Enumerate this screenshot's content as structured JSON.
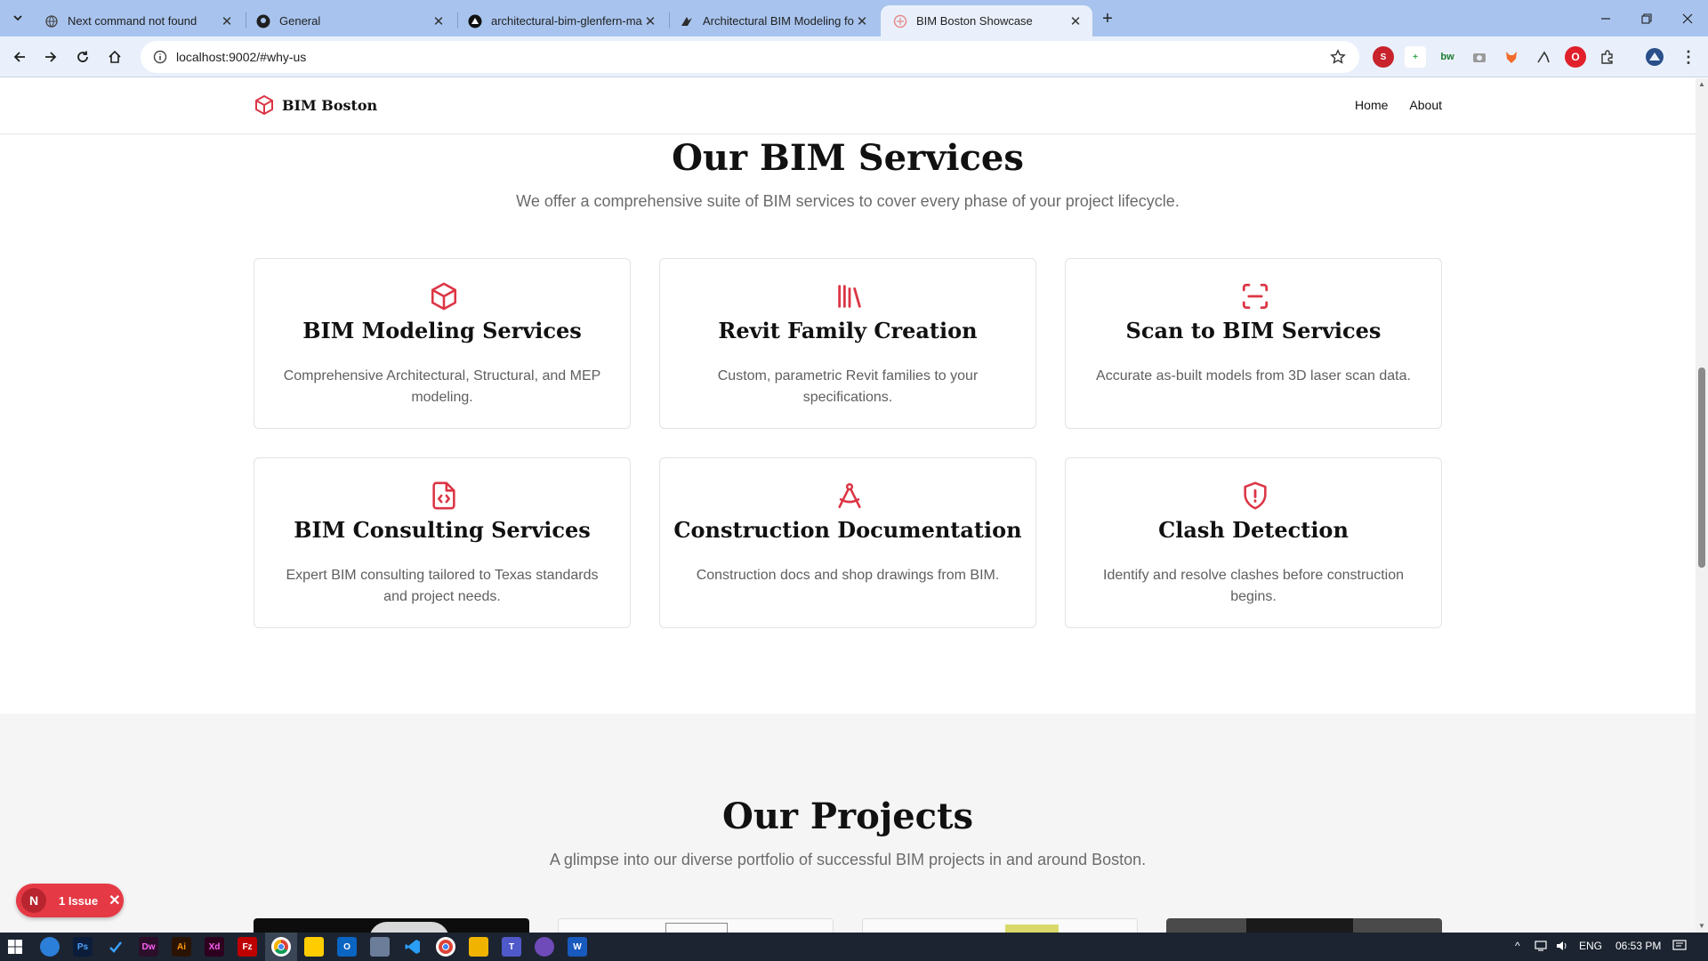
{
  "browser": {
    "tabs": [
      {
        "title": "Next command not found"
      },
      {
        "title": "General"
      },
      {
        "title": "architectural-bim-glenfern-mas"
      },
      {
        "title": "Architectural BIM Modeling for"
      },
      {
        "title": "BIM Boston Showcase"
      }
    ],
    "url": "localhost:9002/#why-us"
  },
  "site": {
    "brand": "BIM Boston",
    "nav": {
      "home": "Home",
      "about": "About"
    },
    "services": {
      "title": "Our BIM Services",
      "subtitle": "We offer a comprehensive suite of BIM services to cover every phase of your project lifecycle.",
      "cards": [
        {
          "title": "BIM Modeling Services",
          "desc": "Comprehensive Architectural, Structural, and MEP modeling.",
          "icon": "cube-icon"
        },
        {
          "title": "Revit Family Creation",
          "desc": "Custom, parametric Revit families to your specifications.",
          "icon": "library-icon"
        },
        {
          "title": "Scan to BIM Services",
          "desc": "Accurate as-built models from 3D laser scan data.",
          "icon": "scan-icon"
        },
        {
          "title": "BIM Consulting Services",
          "desc": "Expert BIM consulting tailored to Texas standards and project needs.",
          "icon": "file-code-icon"
        },
        {
          "title": "Construction Documentation",
          "desc": "Construction docs and shop drawings from BIM.",
          "icon": "compass-icon"
        },
        {
          "title": "Clash Detection",
          "desc": "Identify and resolve clashes before construction begins.",
          "icon": "shield-alert-icon"
        }
      ]
    },
    "projects": {
      "title": "Our Projects",
      "subtitle": "A glimpse into our diverse portfolio of successful BIM projects in and around Boston."
    }
  },
  "issue_badge": {
    "initial": "N",
    "label": "1 Issue"
  },
  "taskbar": {
    "language": "ENG",
    "time": "06:53 PM",
    "apps": [
      "Ps",
      "Dw",
      "Ai",
      "Xd",
      "Fz",
      "W"
    ]
  },
  "colors": {
    "accent": "#dc3545",
    "tabbar": "#a8c4ee",
    "toolbar": "#e9f0fb"
  }
}
